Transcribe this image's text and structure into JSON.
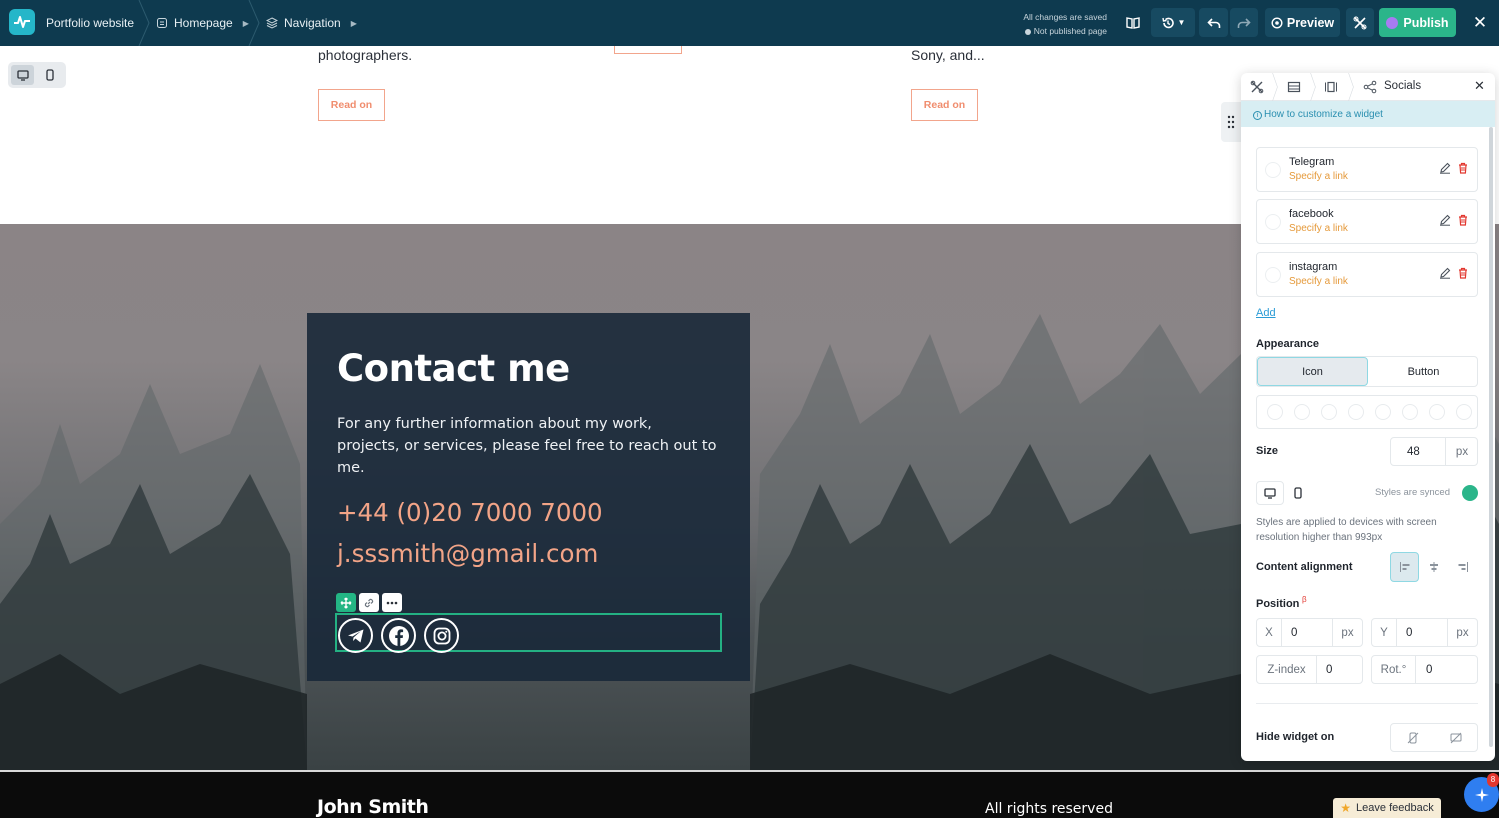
{
  "topbar": {
    "site_name": "Portfolio website",
    "breadcrumbs": [
      {
        "label": "Homepage",
        "icon": "page-icon"
      },
      {
        "label": "Navigation",
        "icon": "layers-icon"
      }
    ],
    "save_status": "All changes are saved",
    "publish_status": "Not published page",
    "preview_label": "Preview",
    "publish_label": "Publish",
    "accent_color": "#2bb58a",
    "bar_color": "#0e3a4f"
  },
  "page": {
    "fragment_left": "photographers.",
    "fragment_right": "Sony, and...",
    "read_on_label": "Read on",
    "contact": {
      "title": "Contact me",
      "description": "For any further information about my work, projects, or services, please feel free to reach out to me.",
      "phone": "+44 (0)20 7000 7000",
      "email": "j.sssmith@gmail.com",
      "socials": [
        "telegram-icon",
        "facebook-icon",
        "instagram-icon"
      ]
    },
    "footer": {
      "name": "John Smith",
      "rights": "All rights reserved"
    },
    "feedback_label": "Leave feedback",
    "fab_badge": "8"
  },
  "panel": {
    "title": "Socials",
    "help_link": "How to customize a widget",
    "links": [
      {
        "name": "Telegram",
        "hint": "Specify a link"
      },
      {
        "name": "facebook",
        "hint": "Specify a link"
      },
      {
        "name": "instagram",
        "hint": "Specify a link"
      }
    ],
    "add_label": "Add",
    "appearance_label": "Appearance",
    "appearance_options": [
      "Icon",
      "Button"
    ],
    "appearance_selected": "Icon",
    "size_label": "Size",
    "size_value": "48",
    "size_unit": "px",
    "synced_label": "Styles are synced",
    "styles_note": "Styles are applied to devices with screen resolution higher than 993px",
    "alignment_label": "Content alignment",
    "position_label": "Position",
    "position_badge": "β",
    "x_label": "X",
    "x_value": "0",
    "y_label": "Y",
    "y_value": "0",
    "unit_px": "px",
    "zindex_label": "Z-index",
    "zindex_value": "0",
    "rotation_label": "Rot.°",
    "rotation_value": "0",
    "hide_label": "Hide widget on"
  }
}
